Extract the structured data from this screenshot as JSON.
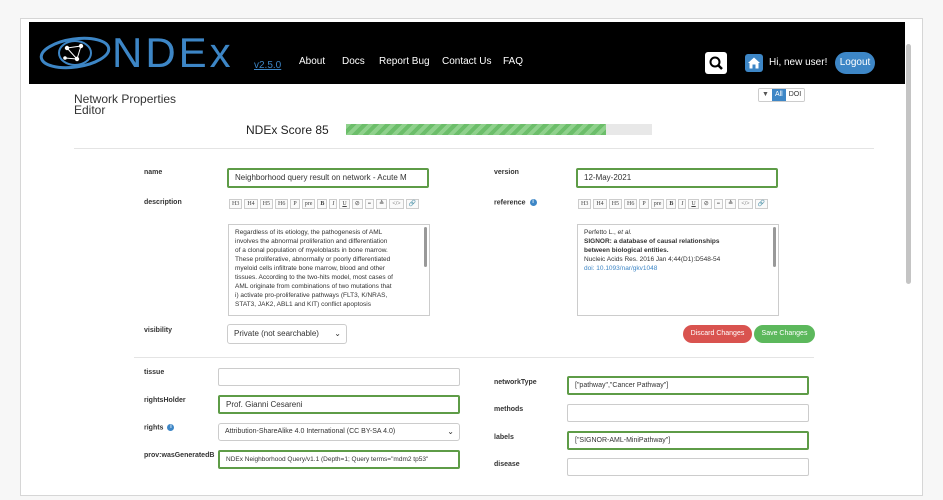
{
  "navbar": {
    "logo": "NDEx",
    "version": "v2.5.0",
    "links": [
      "About",
      "Docs",
      "Report Bug",
      "Contact Us",
      "FAQ"
    ],
    "greeting": "Hi, new user!",
    "logout": "Logout",
    "icons": {
      "search": "search-icon",
      "home": "home-icon"
    }
  },
  "page": {
    "title_line1": "Network Properties",
    "title_line2": "Editor",
    "filters": {
      "all": "All",
      "doi": "DOI"
    }
  },
  "score": {
    "label": "NDEx Score 85",
    "value": 85,
    "max": 100
  },
  "form": {
    "name": {
      "label": "name",
      "value": "Neighborhood  query result on network - Acute M"
    },
    "version": {
      "label": "version",
      "value": "12-May-2021"
    },
    "description": {
      "label": "description",
      "toolbar": [
        "H3",
        "H4",
        "H5",
        "H6",
        "P",
        "pre",
        "B",
        "I",
        "U",
        "⊘",
        "≡",
        "≜",
        "</>",
        "🔗"
      ],
      "lines": [
        "Regardless of its etiology, the pathogenesis of AML",
        "involves the abnormal proliferation and differentiation",
        "of a clonal population of myeloblasts in bone marrow.",
        "These proliferative, abnormally or poorly differentiated",
        "myeloid cells infiltrate bone marrow, blood and other",
        "tissues. According to the two-hits model, most cases of",
        "AML originate from combinations of two mutations that",
        "i) activate pro-proliferative pathways (FLT3, K/NRAS,",
        "STAT3, JAK2, ABL1 and KIT) conflict apoptosis"
      ]
    },
    "reference": {
      "label": "reference",
      "toolbar": [
        "H3",
        "H4",
        "H5",
        "H6",
        "P",
        "pre",
        "B",
        "I",
        "U",
        "⊘",
        "≡",
        "≜",
        "</>",
        "🔗"
      ],
      "authors": "Perfetto L., ",
      "etal": "et al.",
      "title_line1": "SIGNOR: a database of causal relationships",
      "title_line2": "between biological entities.",
      "journal": "Nucleic Acids Res. 2016 Jan 4;44(D1):D548-54",
      "doi": "doi: 10.1093/nar/gkv1048"
    },
    "visibility": {
      "label": "visibility",
      "value": "Private (not searchable)"
    },
    "discard": "Discard Changes",
    "save": "Save Changes",
    "tissue": {
      "label": "tissue",
      "value": ""
    },
    "rightsHolder": {
      "label": "rightsHolder",
      "value": "Prof. Gianni Cesareni"
    },
    "rights": {
      "label": "rights",
      "value": "Attribution-ShareAlike 4.0 International (CC BY-SA 4.0)"
    },
    "provWasGenerated": {
      "label": "prov:wasGeneratedB",
      "value": "NDEx Neighborhood Query/v1.1 (Depth=1; Query terms=\"mdm2 tp53\""
    },
    "networkType": {
      "label": "networkType",
      "value": "[\"pathway\",\"Cancer Pathway\"]"
    },
    "methods": {
      "label": "methods",
      "value": ""
    },
    "labels": {
      "label": "labels",
      "value": "[\"SIGNOR-AML-MiniPathway\"]"
    },
    "disease": {
      "label": "disease",
      "value": ""
    }
  },
  "colors": {
    "navbar": "#000000",
    "brand": "#3d86c6",
    "valid_border": "#5e9c47",
    "discard": "#d9534f",
    "save": "#5cb85c",
    "score_fill": "#6cbe6a"
  }
}
